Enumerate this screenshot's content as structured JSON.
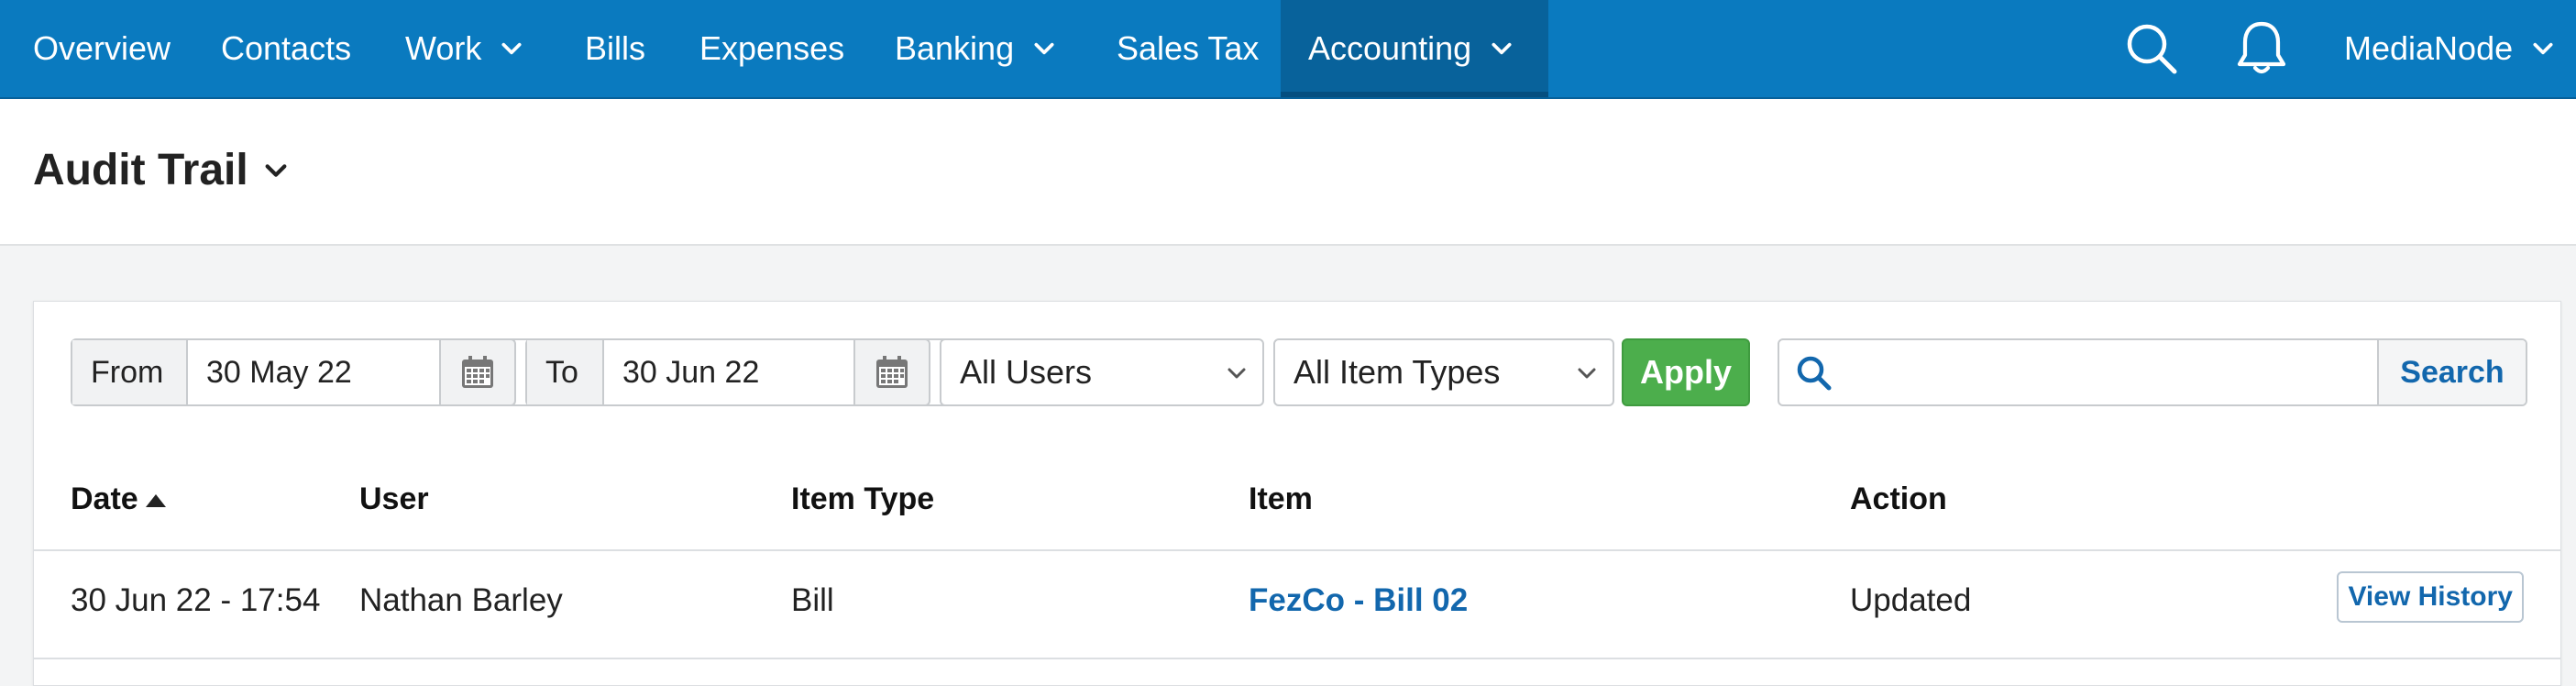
{
  "nav": {
    "items": [
      {
        "label": "Overview"
      },
      {
        "label": "Contacts"
      },
      {
        "label": "Work"
      },
      {
        "label": "Bills"
      },
      {
        "label": "Expenses"
      },
      {
        "label": "Banking"
      },
      {
        "label": "Sales Tax"
      },
      {
        "label": "Accounting"
      }
    ],
    "account_label": "MediaNode"
  },
  "page": {
    "title": "Audit Trail"
  },
  "filters": {
    "from_label": "From",
    "from_value": "30 May 22",
    "to_label": "To",
    "to_value": "30 Jun 22",
    "users_selected": "All Users",
    "item_types_selected": "All Item Types",
    "apply_label": "Apply",
    "search_value": "",
    "search_label": "Search"
  },
  "table": {
    "headers": [
      "Date",
      "User",
      "Item Type",
      "Item",
      "Action"
    ],
    "rows": [
      {
        "date": "30 Jun 22 - 17:54",
        "user": "Nathan Barley",
        "item_type": "Bill",
        "item": "FezCo - Bill 02",
        "action": "Updated",
        "button_label": "View History"
      }
    ]
  },
  "colors": {
    "nav_bg": "#0a7abf",
    "nav_active_bg": "#08629b",
    "apply_bg": "#4cae4c",
    "link": "#1267ad"
  }
}
